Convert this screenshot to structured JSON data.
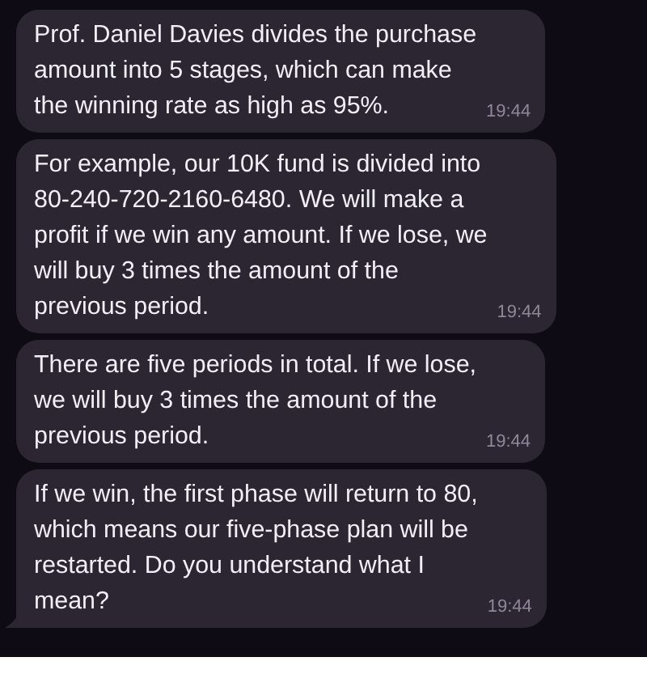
{
  "messages": [
    {
      "text": "Prof. Daniel Davies divides the purchase\namount into 5 stages, which can make\nthe winning rate as high as 95%.",
      "time": "19:44",
      "tail": false
    },
    {
      "text": "For example, our 10K fund is divided into\n80-240-720-2160-6480. We will make a\nprofit if we win any amount. If we lose, we\nwill buy 3 times the amount of the\nprevious period.",
      "time": "19:44",
      "tail": false
    },
    {
      "text": "There are five periods in total. If we lose,\nwe will buy 3 times the amount of the\nprevious period.",
      "time": "19:44",
      "tail": false
    },
    {
      "text": "If we win, the first phase will return to 80,\nwhich means our five-phase plan will be\nrestarted. Do you understand what I\nmean?",
      "time": "19:44",
      "tail": true
    }
  ]
}
